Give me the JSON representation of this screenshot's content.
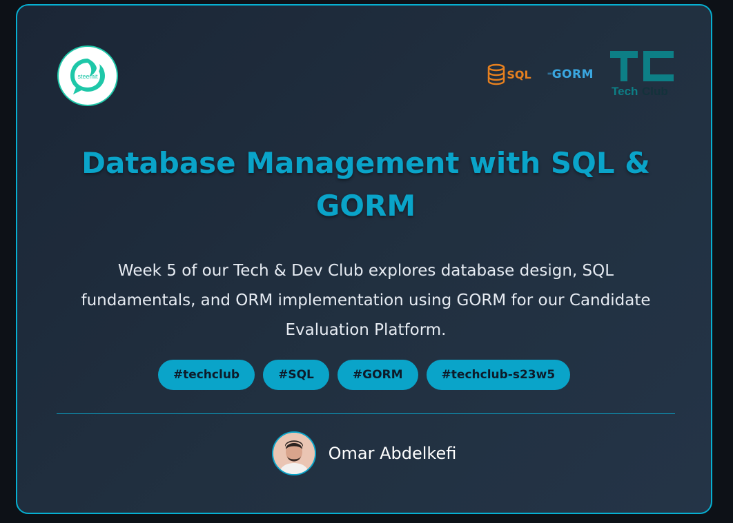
{
  "header": {
    "steemit_logo_text": "steemit",
    "sql_logo_text": "SQL",
    "gorm_logo_text": "GORM",
    "techclub_logo": {
      "tech": "Tech",
      "club": "Club"
    }
  },
  "main": {
    "title": "Database Management with SQL & GORM",
    "description": "Week 5 of our Tech & Dev Club explores database design, SQL fundamentals, and ORM implementation using GORM for our Candidate Evaluation Platform.",
    "tags": [
      "#techclub",
      "#SQL",
      "#GORM",
      "#techclub-s23w5"
    ]
  },
  "author": {
    "name": "Omar Abdelkefi"
  },
  "colors": {
    "accent": "#0aa4c9",
    "background": "#0d1117",
    "card": "#1e2b3b",
    "sql": "#e6801f",
    "gorm": "#3aa7e0",
    "steemit": "#1ec7a8"
  }
}
